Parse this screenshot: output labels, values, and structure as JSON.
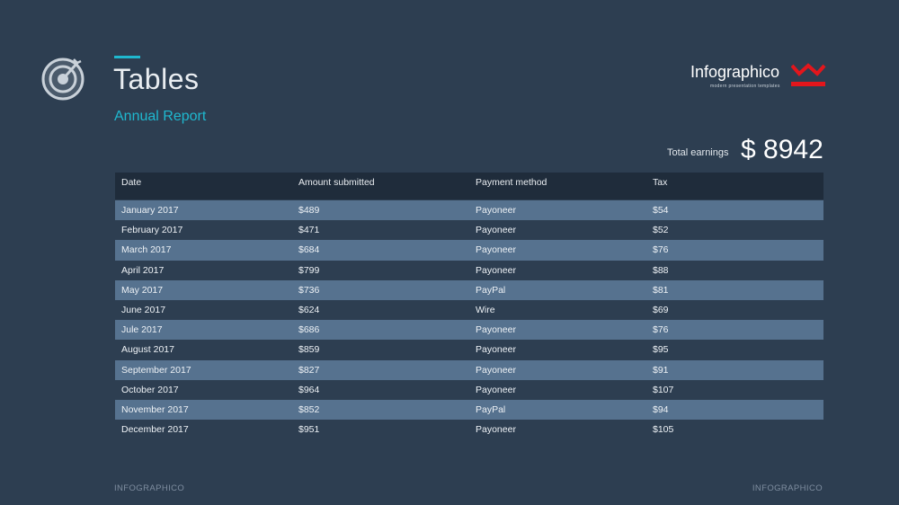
{
  "header": {
    "title": "Tables",
    "subtitle": "Annual Report",
    "icon": "target-icon"
  },
  "brand": {
    "name": "Infographico",
    "tagline": "modern presentation templates",
    "logo_color": "#e3161c"
  },
  "summary": {
    "label": "Total earnings",
    "value": "$ 8942"
  },
  "table": {
    "columns": [
      "Date",
      "Amount submitted",
      "Payment method",
      "Tax"
    ],
    "rows": [
      [
        "January 2017",
        "$489",
        "Payoneer",
        "$54"
      ],
      [
        "February 2017",
        "$471",
        "Payoneer",
        "$52"
      ],
      [
        "March 2017",
        "$684",
        "Payoneer",
        "$76"
      ],
      [
        "April 2017",
        "$799",
        "Payoneer",
        "$88"
      ],
      [
        "May 2017",
        "$736",
        "PayPal",
        "$81"
      ],
      [
        "June 2017",
        "$624",
        "Wire",
        "$69"
      ],
      [
        "Jule 2017",
        "$686",
        "Payoneer",
        "$76"
      ],
      [
        "August 2017",
        "$859",
        "Payoneer",
        "$95"
      ],
      [
        "September 2017",
        "$827",
        "Payoneer",
        "$91"
      ],
      [
        "October 2017",
        "$964",
        "Payoneer",
        "$107"
      ],
      [
        "November 2017",
        "$852",
        "PayPal",
        "$94"
      ],
      [
        "December 2017",
        "$951",
        "Payoneer",
        "$105"
      ]
    ]
  },
  "footer": {
    "left": "INFOGRAPHICO",
    "right": "INFOGRAPHICO"
  },
  "colors": {
    "background": "#2d3e51",
    "accent": "#1fb8cf",
    "header_row": "#1f2c3b",
    "alt_row": "#56728f"
  }
}
